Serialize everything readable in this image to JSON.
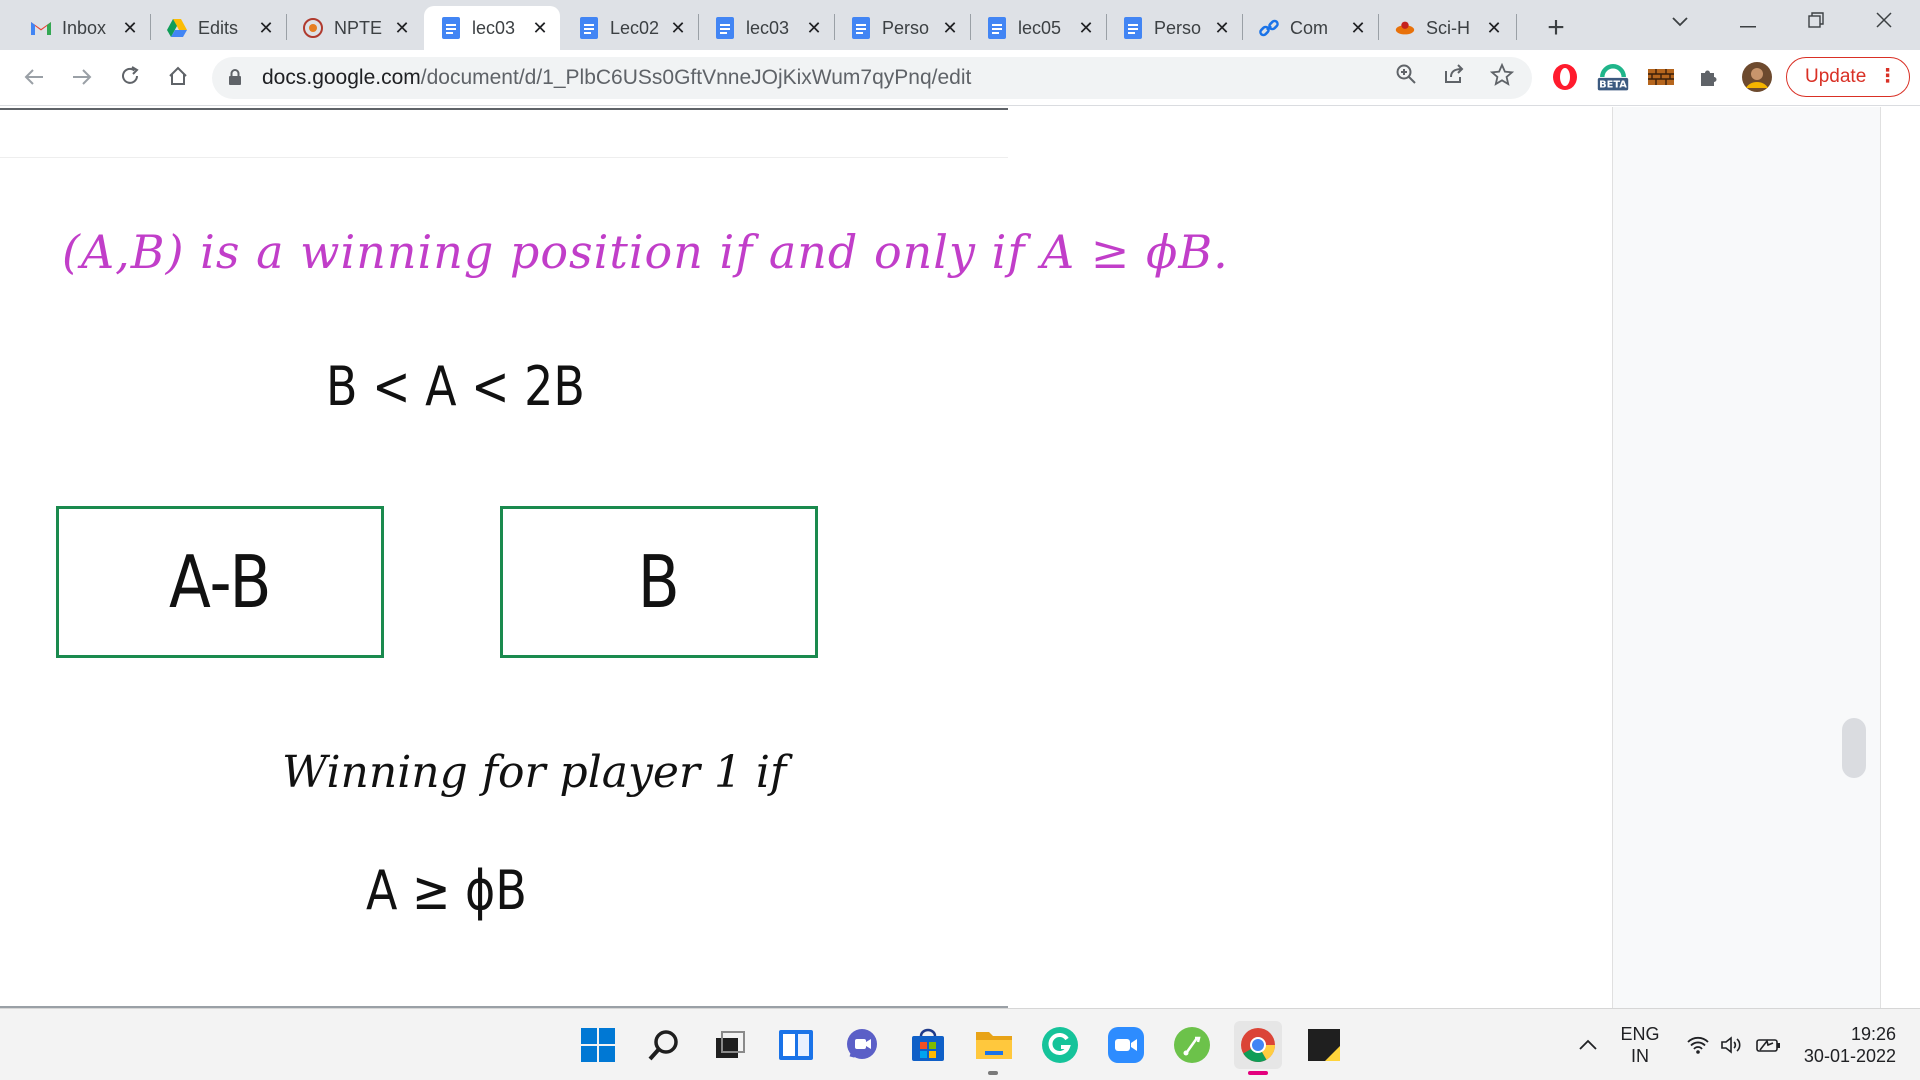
{
  "browser": {
    "tabs": [
      {
        "title": "Inbox",
        "icon": "gmail-icon",
        "active": false
      },
      {
        "title": "Edits",
        "icon": "google-drive-icon",
        "active": false
      },
      {
        "title": "NPTE",
        "icon": "nptel-icon",
        "active": false
      },
      {
        "title": "lec03",
        "icon": "google-docs-icon",
        "active": true
      },
      {
        "title": "Lec02",
        "icon": "google-docs-icon",
        "active": false
      },
      {
        "title": "lec03",
        "icon": "google-docs-icon",
        "active": false
      },
      {
        "title": "Perso",
        "icon": "google-docs-icon",
        "active": false
      },
      {
        "title": "lec05",
        "icon": "google-docs-icon",
        "active": false
      },
      {
        "title": "Perso",
        "icon": "google-docs-icon",
        "active": false
      },
      {
        "title": "Com",
        "icon": "link-icon",
        "active": false
      },
      {
        "title": "Sci-H",
        "icon": "sci-hub-icon",
        "active": false
      }
    ],
    "tab_close": "✕",
    "new_tab": "+",
    "url_host": "docs.google.com",
    "url_path": "/document/d/1_PlbC6USs0GftVnneJOjKixWum7qyPnq/edit",
    "update_label": "Update",
    "beta_badge": "BETA"
  },
  "document": {
    "statement": "(A,B) is a winning position if and only if A ≥ ϕB.",
    "inequality": "B < A < 2B",
    "box_left": "A-B",
    "box_right": "B",
    "winning_label": "Winning for player 1 if",
    "winning_condition": "A ≥ ϕB",
    "colors": {
      "statement": "#c13ec9",
      "box_border": "#1a8a4e"
    }
  },
  "taskbar": {
    "apps": [
      "windows-start-icon",
      "search-icon",
      "task-view-icon",
      "widgets-icon",
      "teams-chat-icon",
      "microsoft-store-icon",
      "file-explorer-icon",
      "grammarly-icon",
      "zoom-icon",
      "feedly-icon",
      "chrome-icon",
      "sticky-notes-icon"
    ],
    "lang_top": "ENG",
    "lang_bottom": "IN",
    "time": "19:26",
    "date": "30-01-2022"
  }
}
